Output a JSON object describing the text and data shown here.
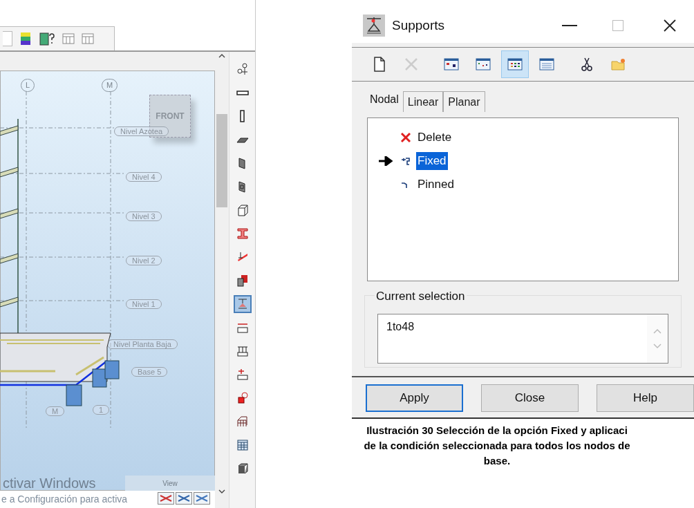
{
  "modeler": {
    "viewport": {
      "grid_axes": [
        "L",
        "M"
      ],
      "level_labels": [
        "Nivel Azotea",
        "Nivel 4",
        "Nivel 3",
        "Nivel 2",
        "Nivel 1",
        "Nivel Planta Baja",
        "Base 5"
      ],
      "node_labels": [
        "M",
        "1"
      ],
      "view_cube": "FRONT",
      "view_tab": "View"
    },
    "watermark_lines": [
      "ctivar Windows",
      "e a Configuración para activa"
    ],
    "tools": [
      {
        "selected": false
      },
      {
        "selected": false
      },
      {
        "selected": false
      },
      {
        "selected": false
      },
      {
        "selected": false
      },
      {
        "selected": false
      },
      {
        "selected": false
      },
      {
        "selected": false
      },
      {
        "selected": false
      },
      {
        "selected": false
      },
      {
        "selected": true
      },
      {
        "selected": false
      },
      {
        "selected": false
      },
      {
        "selected": false
      },
      {
        "selected": false
      },
      {
        "selected": false
      },
      {
        "selected": false
      },
      {
        "selected": false
      }
    ]
  },
  "dialog": {
    "title": "Supports",
    "toolbar": [
      {
        "selected": false,
        "disabled": false
      },
      {
        "selected": false,
        "disabled": true
      },
      {
        "selected": false,
        "disabled": false
      },
      {
        "selected": false,
        "disabled": false
      },
      {
        "selected": true,
        "disabled": false
      },
      {
        "selected": false,
        "disabled": false
      },
      {
        "selected": false,
        "disabled": false
      },
      {
        "selected": false,
        "disabled": false
      }
    ],
    "tabs": [
      {
        "label": "Nodal",
        "selected": true
      },
      {
        "label": "Linear",
        "selected": false
      },
      {
        "label": "Planar",
        "selected": false
      }
    ],
    "support_types": [
      {
        "kind": "delete",
        "label": "Delete",
        "selected": false,
        "current": false
      },
      {
        "kind": "fixed",
        "label": "Fixed",
        "selected": true,
        "current": true
      },
      {
        "kind": "pinned",
        "label": "Pinned",
        "selected": false,
        "current": false
      }
    ],
    "current_selection": {
      "label": "Current selection",
      "value": "1to48"
    },
    "buttons": [
      {
        "label": "Apply",
        "default": true
      },
      {
        "label": "Close",
        "default": false
      },
      {
        "label": "Help",
        "default": false
      }
    ]
  },
  "caption": [
    "Ilustración 30 Selección de la opción Fixed y aplicaci",
    "de la condición seleccionada para todos los nodos de",
    "base."
  ]
}
